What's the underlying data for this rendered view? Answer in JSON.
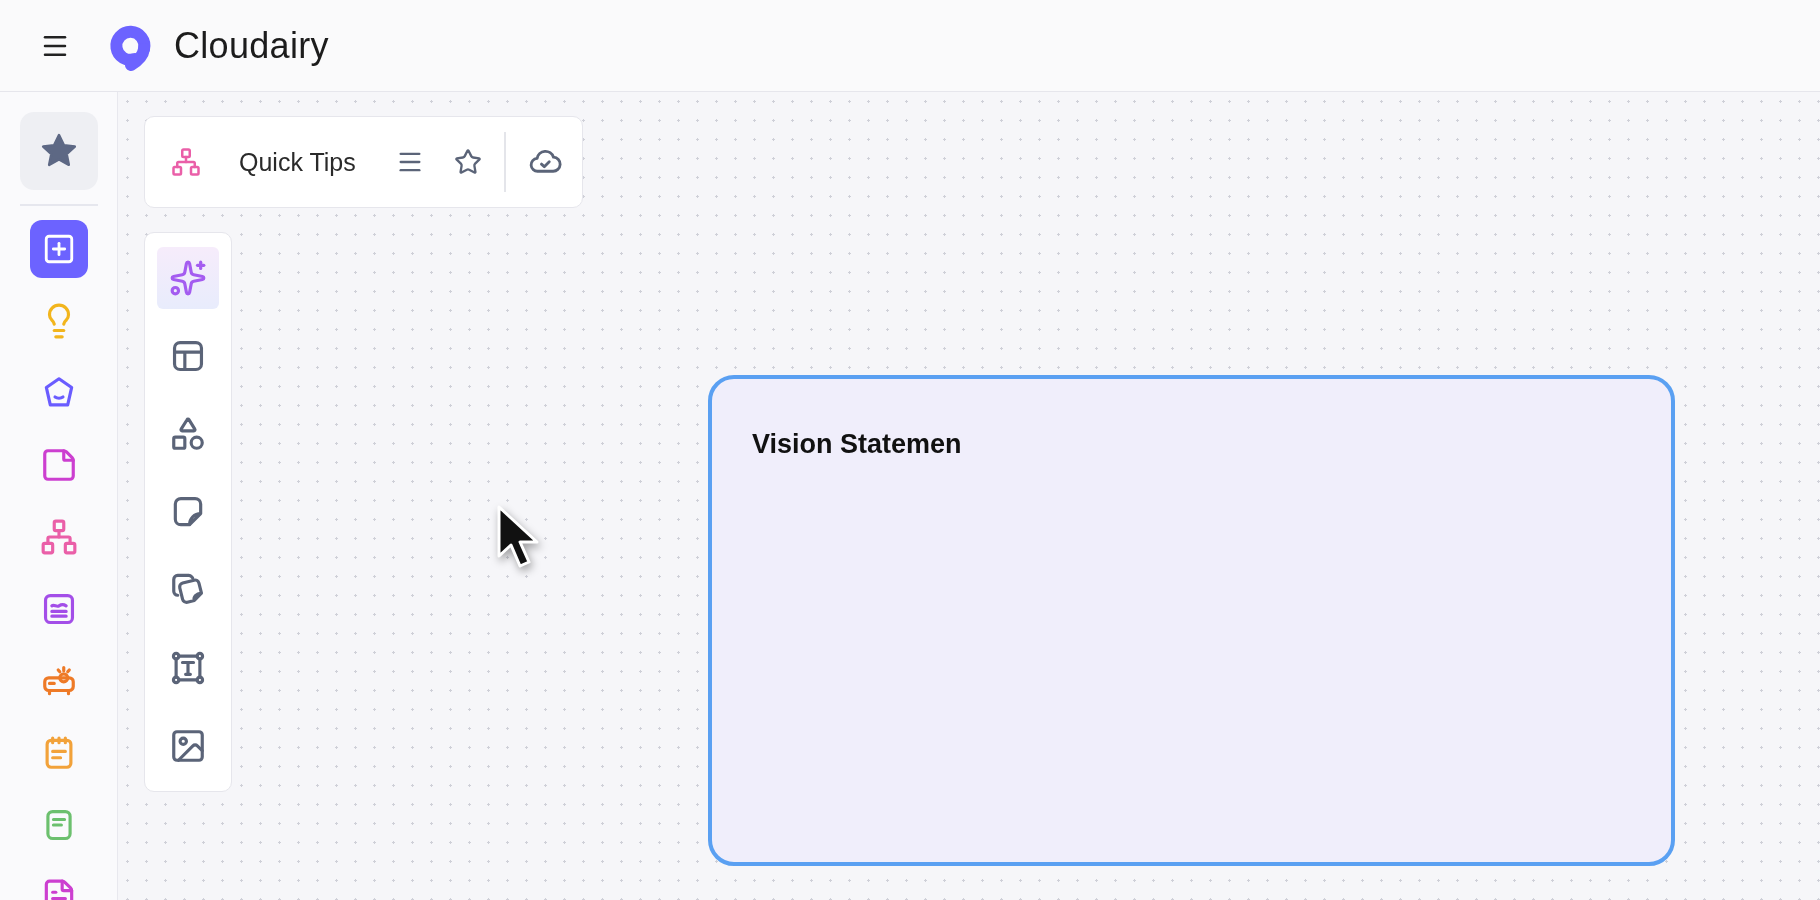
{
  "header": {
    "brand": "Cloudairy"
  },
  "sidebar": {
    "items": [
      {
        "kind": "favorites",
        "selected": true
      },
      {
        "kind": "create",
        "selected": false
      },
      {
        "kind": "ideas",
        "selected": false
      },
      {
        "kind": "brand",
        "selected": false
      },
      {
        "kind": "notes",
        "selected": false
      },
      {
        "kind": "flowchart",
        "selected": false
      },
      {
        "kind": "chart",
        "selected": false
      },
      {
        "kind": "presentation",
        "selected": false
      },
      {
        "kind": "notepad",
        "selected": false
      },
      {
        "kind": "document",
        "selected": false
      },
      {
        "kind": "file",
        "selected": false
      }
    ]
  },
  "board_toolbar": {
    "title": "Quick Tips"
  },
  "tools": [
    {
      "kind": "ai",
      "selected": true
    },
    {
      "kind": "layout",
      "selected": false
    },
    {
      "kind": "shapes",
      "selected": false
    },
    {
      "kind": "sticky",
      "selected": false
    },
    {
      "kind": "stickies",
      "selected": false
    },
    {
      "kind": "text",
      "selected": false
    },
    {
      "kind": "image",
      "selected": false
    }
  ],
  "canvas": {
    "card": {
      "title": "Vision Statemen"
    }
  }
}
